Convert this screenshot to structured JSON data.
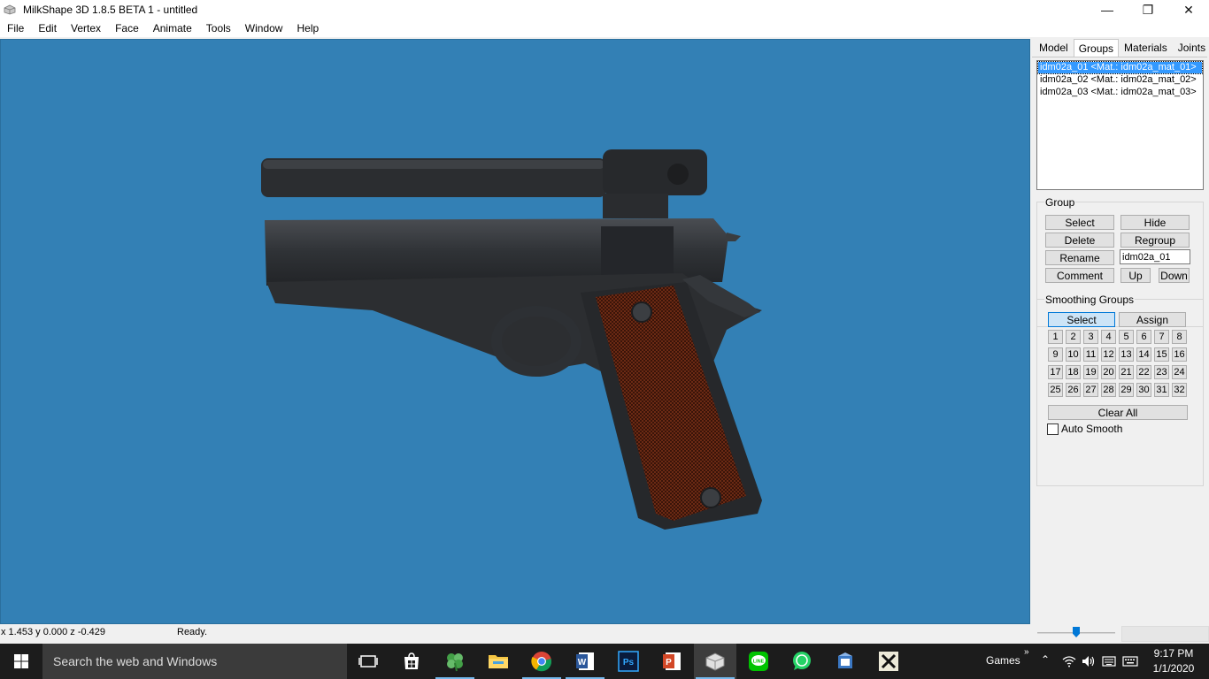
{
  "window": {
    "title": "MilkShape 3D 1.8.5 BETA 1 - untitled",
    "controls": {
      "minimize": "—",
      "maximize": "❐",
      "close": "✕"
    }
  },
  "menu": [
    "File",
    "Edit",
    "Vertex",
    "Face",
    "Animate",
    "Tools",
    "Window",
    "Help"
  ],
  "viewport": {
    "background": "#3380b5"
  },
  "panel": {
    "tabs": [
      "Model",
      "Groups",
      "Materials",
      "Joints"
    ],
    "active_tab": "Groups",
    "groups_list": [
      "idm02a_01 <Mat.: idm02a_mat_01>",
      "idm02a_02 <Mat.: idm02a_mat_02>",
      "idm02a_03 <Mat.: idm02a_mat_03>"
    ],
    "group_section": {
      "label": "Group",
      "select": "Select",
      "hide": "Hide",
      "delete": "Delete",
      "regroup": "Regroup",
      "rename": "Rename",
      "name_value": "idm02a_01",
      "comment": "Comment",
      "up": "Up",
      "down": "Down"
    },
    "smoothing": {
      "label": "Smoothing Groups",
      "select": "Select",
      "assign": "Assign",
      "numbers": [
        "1",
        "2",
        "3",
        "4",
        "5",
        "6",
        "7",
        "8",
        "9",
        "10",
        "11",
        "12",
        "13",
        "14",
        "15",
        "16",
        "17",
        "18",
        "19",
        "20",
        "21",
        "22",
        "23",
        "24",
        "25",
        "26",
        "27",
        "28",
        "29",
        "30",
        "31",
        "32"
      ],
      "clear_all": "Clear All",
      "auto_smooth": "Auto Smooth"
    }
  },
  "status": {
    "coords": "x 1.453 y 0.000 z -0.429",
    "message": "Ready."
  },
  "taskbar": {
    "search_placeholder": "Search the web and Windows",
    "games_label": "Games",
    "time": "9:17 PM",
    "date": "1/1/2020",
    "accent": "#76b9ed"
  }
}
